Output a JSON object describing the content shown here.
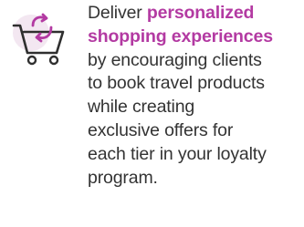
{
  "feature": {
    "icon": "shopping-cart-refresh-icon",
    "lead": "Deliver",
    "highlight_1": "personalized",
    "highlight_2": "shopping experiences",
    "body_1": "by encouraging clients",
    "body_2": "to book travel products",
    "body_3": "while creating",
    "body_4": "exclusive offers for",
    "body_5": "each tier in your loyalty",
    "body_6": "program."
  },
  "colors": {
    "accent": "#b33aa2",
    "text": "#333333",
    "icon_bg": "#f3e7f1",
    "icon_stroke": "#2f2f2f"
  }
}
